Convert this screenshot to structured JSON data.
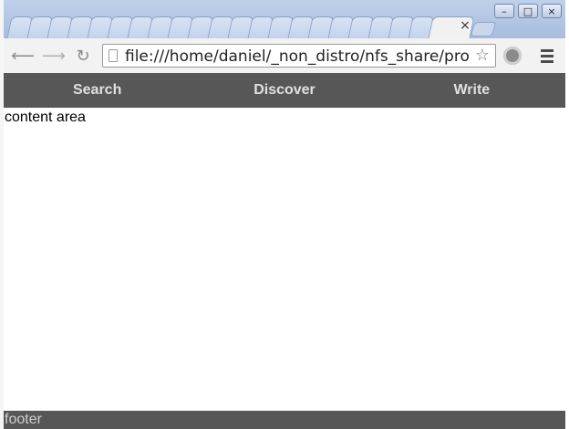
{
  "browser": {
    "url": "file:///home/daniel/_non_distro/nfs_share/pro",
    "tab_close_glyph": "×"
  },
  "page": {
    "nav": {
      "items": [
        {
          "label": "Search"
        },
        {
          "label": "Discover"
        },
        {
          "label": "Write"
        }
      ]
    },
    "content_text": "content area",
    "footer_text": "footer"
  },
  "colors": {
    "tabstrip": "#a7bddf",
    "navbar": "#575757",
    "footer": "#575757",
    "nav_text": "#e0e0e0"
  },
  "icons": {
    "back": "back-arrow-icon",
    "forward": "forward-arrow-icon",
    "reload": "reload-icon",
    "star": "star-icon",
    "extension": "extension-icon",
    "menu": "menu-icon",
    "minimize": "minimize-icon",
    "maximize": "maximize-icon",
    "close": "close-icon"
  }
}
